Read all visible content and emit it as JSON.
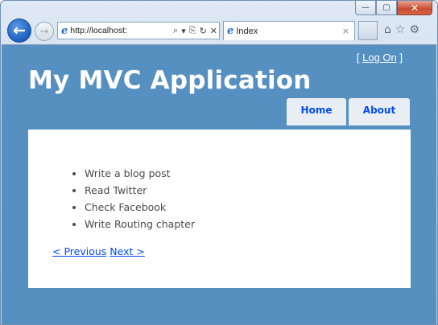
{
  "browser": {
    "url": "http://localhost:",
    "address_controls": [
      "⌕",
      "▾",
      "⎘",
      "↻",
      "✕"
    ],
    "tab": {
      "title": "Index",
      "close": "×"
    },
    "window_buttons": {
      "minimize": "—",
      "maximize": "▢",
      "close": "✕"
    },
    "toolbar_icons": [
      "home-icon",
      "favorites-star-icon",
      "tools-gear-icon"
    ],
    "colors": {
      "back_button": "#1a5fc0",
      "ie_logo": "#1f6fd1"
    }
  },
  "site": {
    "logon": {
      "open": "[ ",
      "link": "Log On",
      "close": " ]"
    },
    "title": "My MVC Application",
    "menu": [
      "Home",
      "About"
    ],
    "colors": {
      "page_bg": "#5690c0",
      "content_bg": "#ffffff",
      "link": "#034af3",
      "menu_tab_bg": "#e8eef4"
    }
  },
  "content": {
    "items": [
      "Write a blog post",
      "Read Twitter",
      "Check Facebook",
      "Write Routing chapter"
    ],
    "pager": {
      "previous": "< Previous",
      "next": "Next >"
    }
  }
}
